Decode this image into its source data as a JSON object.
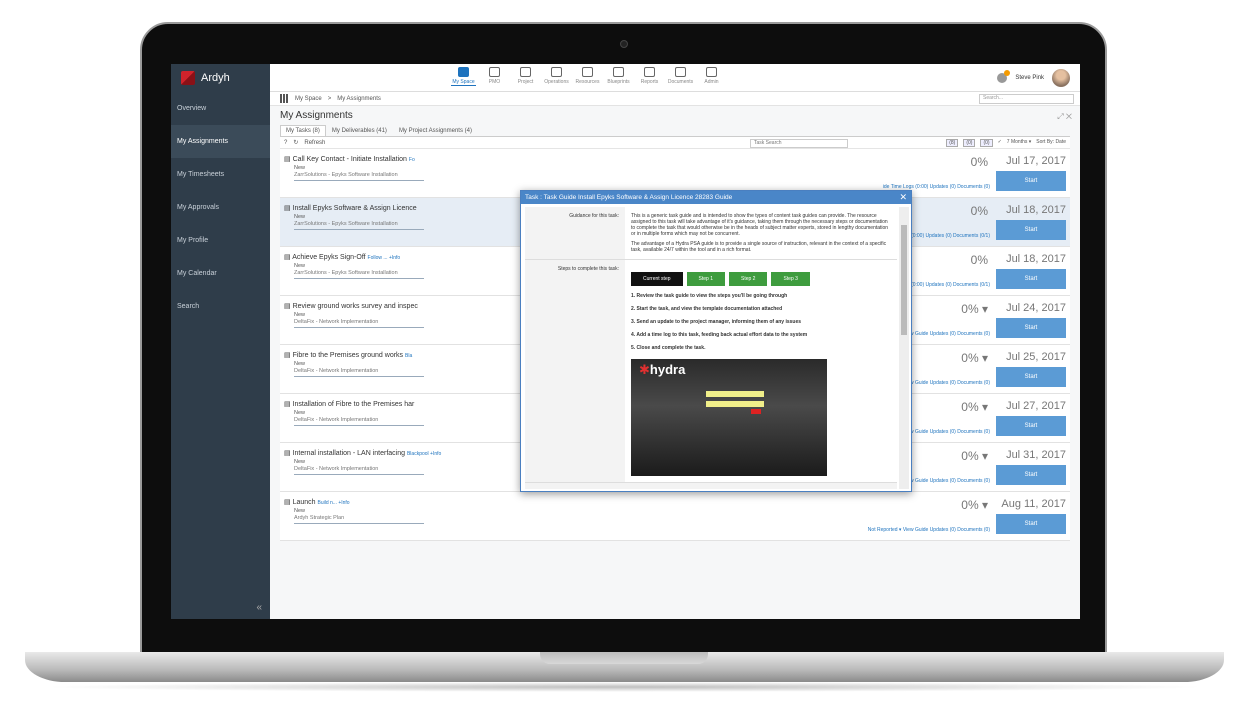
{
  "app": {
    "name": "Ardyh",
    "user": "Steve Pink"
  },
  "nav": [
    "My Space",
    "PMO",
    "Project",
    "Operations",
    "Resources",
    "Blueprints",
    "Reports",
    "Documents",
    "Admin"
  ],
  "sidebar": [
    "Overview",
    "My Assignments",
    "My Timesheets",
    "My Approvals",
    "My Profile",
    "My Calendar",
    "Search"
  ],
  "breadcrumb": {
    "root": "My Space",
    "sep": ">",
    "current": "My Assignments"
  },
  "search_placeholder": "Search...",
  "page_title": "My Assignments",
  "tabs": [
    "My Tasks (8)",
    "My Deliverables (41)",
    "My Project Assignments (4)"
  ],
  "toolbar": {
    "refresh": "Refresh",
    "task_search": "Task Search",
    "b1": "(8)",
    "b2": "(0)",
    "b3": "(0)",
    "range": "7 Months ▾",
    "sort": "Sort By: Date"
  },
  "tasks": [
    {
      "title": "Call Key Contact - Initiate Installation",
      "link": "Fo",
      "status": "New",
      "project": "ZarrSolutions - Epyks Software Installation",
      "pct": "0%",
      "date": "Jul 17, 2017",
      "links": "ide  Time Logs (0:00)  Updates (0)  Documents (0)"
    },
    {
      "title": "Install Epyks Software & Assign Licence",
      "link": "",
      "status": "New",
      "project": "ZarrSolutions - Epyks Software Installation",
      "pct": "0%",
      "date": "Jul 18, 2017",
      "links": "ide  Time Logs (0:00)  Updates (0)  Documents (0/1)"
    },
    {
      "title": "Achieve Epyks Sign-Off",
      "link": "Follow ... +Info",
      "status": "New",
      "project": "ZarrSolutions - Epyks Software Installation",
      "pct": "0%",
      "date": "Jul 18, 2017",
      "links": "ide  Time Logs (0:00)  Updates (0)  Documents (0/1)"
    },
    {
      "title": "Review ground works survey and inspec",
      "link": "",
      "status": "New",
      "project": "DeltaFix - Network Implementation",
      "pct": "0% ▾",
      "date": "Jul 24, 2017",
      "links": "ported ▾  View Guide  Updates (0)  Documents (0)"
    },
    {
      "title": "Fibre to the Premises ground works",
      "link": "Bla",
      "status": "New",
      "project": "DeltaFix - Network Implementation",
      "pct": "0% ▾",
      "date": "Jul 25, 2017",
      "links": "ported ▾  View Guide  Updates (0)  Documents (0)"
    },
    {
      "title": "Installation of Fibre to the Premises har",
      "link": "",
      "status": "New",
      "project": "DeltaFix - Network Implementation",
      "pct": "0% ▾",
      "date": "Jul 27, 2017",
      "links": "ported ▾  View Guide  Updates (0)  Documents (0)"
    },
    {
      "title": "Internal installation - LAN interfacing",
      "link": "Blackpool +Info",
      "status": "New",
      "project": "DeltaFix - Network Implementation",
      "pct": "0% ▾",
      "date": "Jul 31, 2017",
      "links": "Not Reported ▾  View Guide  Updates (0)  Documents (0)"
    },
    {
      "title": "Launch",
      "link": "Build n... +Info",
      "status": "New",
      "project": "Ardyh Strategic Plan",
      "pct": "0% ▾",
      "date": "Aug 11, 2017",
      "links": "Not Reported ▾  View Guide  Updates (0)  Documents (0)"
    }
  ],
  "start_label": "Start",
  "modal": {
    "title": "Task : Task Guide Install Epyks Software & Assign Licence 28283 Guide",
    "guidance_label": "Guidance for this task:",
    "guidance_text": "This is a generic task guide and is intended to show the types of content task guides can provide. The resource assigned to this task will take advantage of it's guidance, taking them through the necessary steps or documentation to complete the task that would otherwise be in the heads of subject matter experts, stored in lengthy documentation or in multiple forms which may not be concurrent.",
    "guidance_text2": "The advantage of a Hydra PSA guide is to provide a single source of instruction, relevant in the context of a specific task, available 24/7 within the tool and in a rich format.",
    "steps_label": "Steps to complete this task:",
    "step_buttons": [
      "Current step",
      "Step 1",
      "Step 2",
      "Step 3"
    ],
    "steps": [
      "1. Review the task guide to view the steps you'll be going through",
      "2. Start the task, and view the template documentation attached",
      "3. Send an update to the project manager, informing them of any issues",
      "4. Add a time log to this task, feeding back actual effort data to the system",
      "5. Close and complete the task."
    ],
    "image_brand": "hydra"
  }
}
